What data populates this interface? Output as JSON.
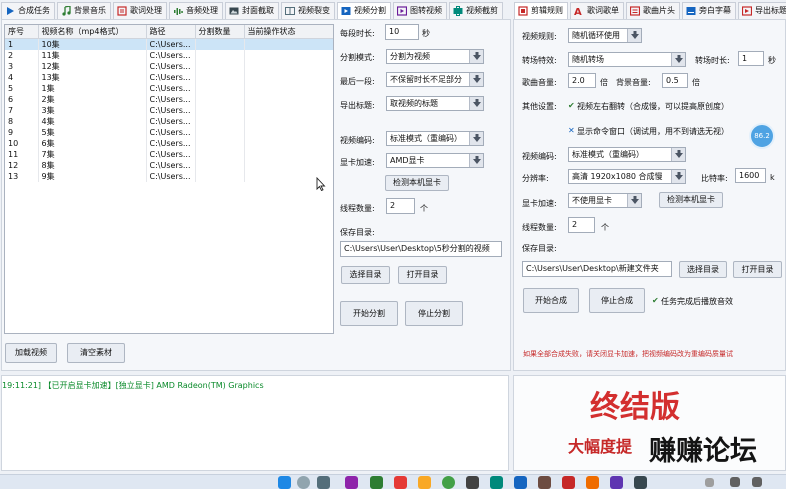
{
  "left_tabs": [
    {
      "label": "合成任务",
      "icon": "play-icon",
      "color": "#1565c0"
    },
    {
      "label": "背景音乐",
      "icon": "music-note-icon",
      "color": "#2e7d32"
    },
    {
      "label": "歌词处理",
      "icon": "lyrics-icon",
      "color": "#c62828"
    },
    {
      "label": "音频处理",
      "icon": "audio-icon",
      "color": "#2e7d32"
    },
    {
      "label": "封面截取",
      "icon": "image-icon",
      "color": "#37474f"
    },
    {
      "label": "视频裂变",
      "icon": "split-video-icon",
      "color": "#546e7a"
    },
    {
      "label": "视频分割",
      "icon": "scissors-icon",
      "color": "#1565c0"
    },
    {
      "label": "图转视频",
      "icon": "image-to-video-icon",
      "color": "#6a1b9a"
    },
    {
      "label": "视频截剪",
      "icon": "cut-icon",
      "color": "#00897b"
    }
  ],
  "right_tabs": [
    {
      "label": "剪辑规则",
      "icon": "rule-icon",
      "color": "#c62828"
    },
    {
      "label": "歌词歌单",
      "icon": "font-icon",
      "color": "#c62828"
    },
    {
      "label": "歌曲片头",
      "icon": "song-intro-icon",
      "color": "#c62828"
    },
    {
      "label": "旁白字幕",
      "icon": "subtitle-icon",
      "color": "#1565c0"
    },
    {
      "label": "导出标题",
      "icon": "export-icon",
      "color": "#c62828"
    }
  ],
  "video_table": {
    "columns": [
      "序号",
      "视频名称（mp4格式）",
      "路径",
      "分割数量",
      "当前操作状态"
    ],
    "rows": [
      [
        "1",
        "10集",
        "C:\\Users...",
        "",
        ""
      ],
      [
        "2",
        "11集",
        "C:\\Users...",
        "",
        ""
      ],
      [
        "3",
        "12集",
        "C:\\Users...",
        "",
        ""
      ],
      [
        "4",
        "13集",
        "C:\\Users...",
        "",
        ""
      ],
      [
        "5",
        "1集",
        "C:\\Users...",
        "",
        ""
      ],
      [
        "6",
        "2集",
        "C:\\Users...",
        "",
        ""
      ],
      [
        "7",
        "3集",
        "C:\\Users...",
        "",
        ""
      ],
      [
        "8",
        "4集",
        "C:\\Users...",
        "",
        ""
      ],
      [
        "9",
        "5集",
        "C:\\Users...",
        "",
        ""
      ],
      [
        "10",
        "6集",
        "C:\\Users...",
        "",
        ""
      ],
      [
        "11",
        "7集",
        "C:\\Users...",
        "",
        ""
      ],
      [
        "12",
        "8集",
        "C:\\Users...",
        "",
        ""
      ],
      [
        "13",
        "9集",
        "C:\\Users...",
        "",
        ""
      ]
    ],
    "add_button": "加载视频",
    "clear_button": "清空素材"
  },
  "split": {
    "duration_label": "每段时长:",
    "duration_value": "10",
    "duration_unit": "秒",
    "mode_label": "分割模式:",
    "mode_value": "分割为视频",
    "last_label": "最后一段:",
    "last_value": "不保留时长不足部分",
    "title_label": "导出标题:",
    "title_value": "取视频的标题",
    "codec_label": "视频编码:",
    "codec_value": "标准模式（重编码）",
    "gpu_label": "显卡加速:",
    "gpu_value": "AMD显卡",
    "detect_button": "检测本机显卡",
    "threads_label": "线程数量:",
    "threads_value": "2",
    "threads_unit": "个",
    "save_label": "保存目录:",
    "save_path": "C:\\Users\\User\\Desktop\\5秒分割的视频",
    "choose_dir": "选择目录",
    "open_dir": "打开目录",
    "start": "开始分割",
    "stop": "停止分割"
  },
  "log_text": "19:11:21] 【已开启显卡加速】[独立显卡] AMD Radeon(TM) Graphics",
  "right": {
    "rule_label": "视频规则:",
    "rule_value": "随机循环使用",
    "trans_label": "转场特效:",
    "trans_value": "随机转场",
    "trans_dur_label": "转场时长:",
    "trans_dur_value": "1",
    "trans_dur_unit": "秒",
    "song_vol_label": "歌曲音量:",
    "song_vol_value": "2.0",
    "vol_unit": "倍",
    "bg_vol_label": "背景音量:",
    "bg_vol_value": "0.5",
    "bg_vol_unit": "倍",
    "other_label": "其他设置:",
    "check1": "视频左右翻转（合成慢，可以提高原创度）",
    "check2": "显示命令窗口（调试用，用不到请选无视）",
    "badge": "86.2",
    "codec_label": "视频编码:",
    "codec_value": "标准模式（重编码）",
    "res_label": "分辨率:",
    "res_value": "高清 1920x1080 合成慢",
    "bitrate_label": "比特率:",
    "bitrate_value": "1600",
    "bitrate_unit": "k",
    "gpu_label": "显卡加速:",
    "gpu_value": "不使用显卡",
    "detect_button": "检测本机显卡",
    "threads_label": "线程数量:",
    "threads_value": "2",
    "threads_unit": "个",
    "save_label": "保存目录:",
    "save_path": "C:\\Users\\User\\Desktop\\新建文件夹",
    "choose_dir": "选择目录",
    "open_dir": "打开目录",
    "start": "开始合成",
    "stop": "停止合成",
    "done_check": "任务完成后播放音效",
    "warning": "如果全部合成失败，请关闭显卡加速，把视频编码改为重编码质量试"
  },
  "promo": {
    "title": "终结版",
    "subtitle": "大幅度提",
    "watermark": "赚赚论坛"
  },
  "colors": {
    "accent_red": "#c62828",
    "log_green": "#0a8a2a",
    "promo_red": "#d32f2f",
    "badge_blue": "#4fa3e3"
  }
}
